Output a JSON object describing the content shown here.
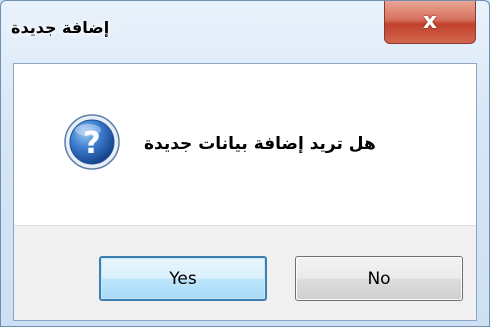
{
  "window": {
    "title": "إضافة جديدة",
    "close_glyph": "x"
  },
  "dialog": {
    "message": "هل تريد إضافة بيانات جديدة",
    "icon": "question-icon"
  },
  "buttons": {
    "yes_label": "Yes",
    "no_label": "No"
  },
  "colors": {
    "frame": "#d6e6f6",
    "close_button": "#c2412c",
    "default_button_border": "#3c7fb1",
    "question_icon": "#2a67b5"
  }
}
